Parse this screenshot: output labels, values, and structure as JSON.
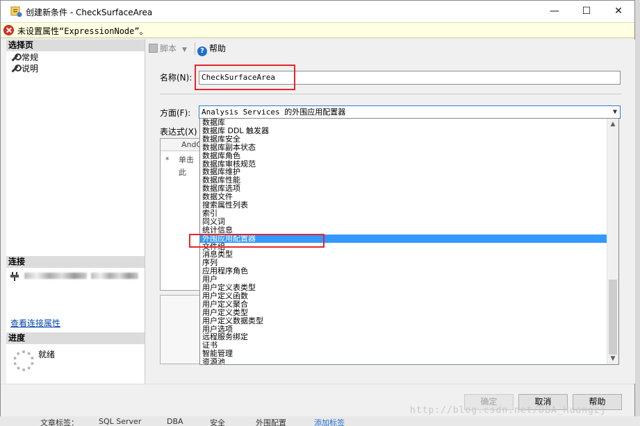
{
  "window": {
    "title": "创建新条件 - CheckSurfaceArea",
    "minimize": "—",
    "maximize": "☐",
    "close": "✕"
  },
  "error": {
    "message": "未设置属性“ExpressionNode”。"
  },
  "sidebar": {
    "select_page_header": "选择页",
    "pages": [
      {
        "label": "常规"
      },
      {
        "label": "说明"
      }
    ],
    "connection_header": "连接",
    "view_connection_link": "查看连接属性",
    "progress_header": "进度",
    "progress_status": "就绪"
  },
  "toolbar": {
    "script_label": "脚本",
    "help_label": "帮助"
  },
  "form": {
    "name_label": "名称(N):",
    "name_value": "CheckSurfaceArea",
    "facet_label": "方面(F):",
    "facet_value": "Analysis Services 的外围应用配置器",
    "expression_label": "表达式(X)",
    "grid_header": "AndO",
    "grid_row_marker": "*",
    "grid_row_placeholder": "单击此"
  },
  "dropdown": {
    "items": [
      "数据库",
      "数据库 DDL 触发器",
      "数据库安全",
      "数据库副本状态",
      "数据库角色",
      "数据库审核规范",
      "数据库维护",
      "数据库性能",
      "数据库选项",
      "数据文件",
      "搜索属性列表",
      "索引",
      "同义词",
      "统计信息",
      "外围应用配置器",
      "文件组",
      "消息类型",
      "序列",
      "应用程序角色",
      "用户",
      "用户定义表类型",
      "用户定义函数",
      "用户定义聚合",
      "用户定义类型",
      "用户定义数据类型",
      "用户选项",
      "远程服务绑定",
      "证书",
      "智能管理",
      "资源池"
    ],
    "selected_index": 14
  },
  "buttons": {
    "ok": "确定",
    "cancel": "取消",
    "help": "帮助"
  },
  "watermark": "http://blog.csdn.net/DBA_Huangzj",
  "taskbar": [
    "文章标签：",
    "SQL Server",
    "DBA",
    "安全",
    "外围配置",
    "添加标签"
  ]
}
